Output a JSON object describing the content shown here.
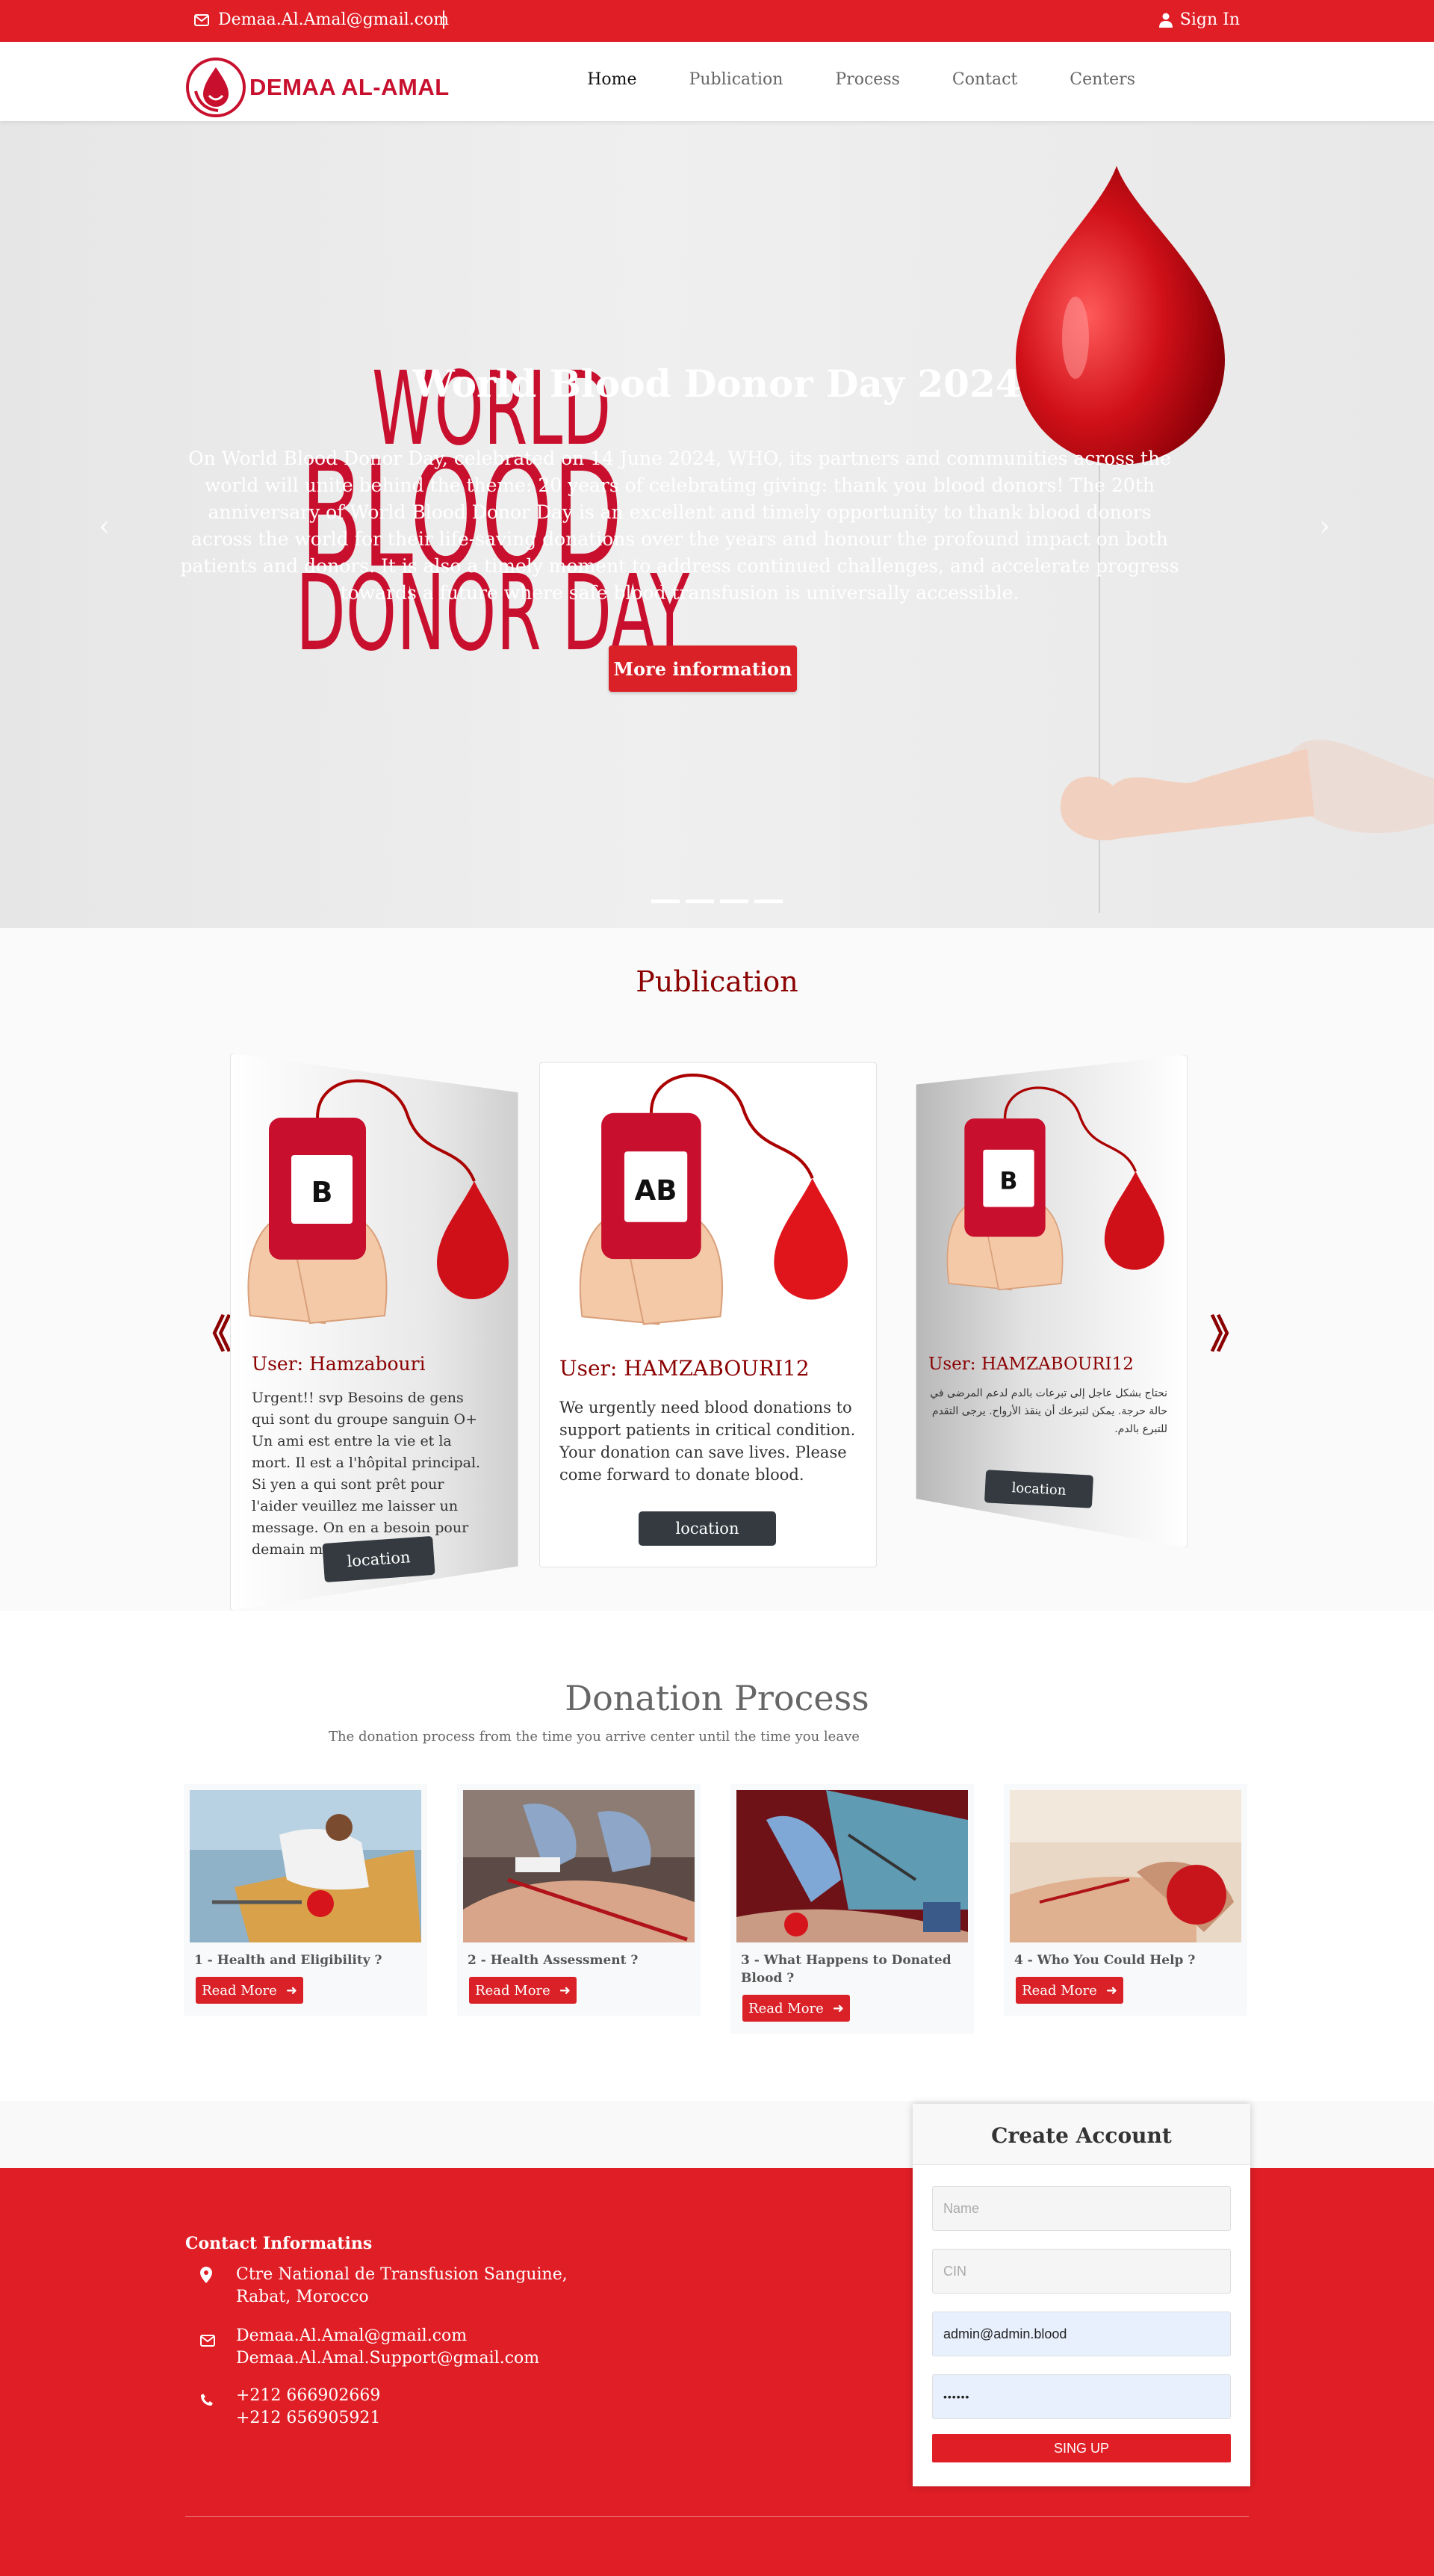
{
  "topbar": {
    "email": "Demaa.Al.Amal@gmail.com",
    "separator": "|",
    "signin": "Sign In"
  },
  "brand": {
    "name": "DEMAA AL-AMAL",
    "color": "#c8102e"
  },
  "nav": {
    "items": [
      "Home",
      "Publication",
      "Process",
      "Contact",
      "Centers"
    ],
    "active": "Home"
  },
  "hero": {
    "bg_word_1": "WORLD",
    "bg_word_2": "BLOOD",
    "bg_word_3": "DONOR DAY",
    "title": "World Blood Donor Day 2024",
    "description": "On World Blood Donor Day, celebrated on 14 June 2024, WHO, its partners and communities across the world will unite behind the theme: 20 years of celebrating giving: thank you blood donors! The 20th anniversary of World Blood Donor Day is an excellent and timely opportunity to thank blood donors across the world for their life-saving donations over the years and honour the profound impact on both patients and donors. It is also a timely moment to address continued challenges, and accelerate progress towards a future where safe blood transfusion is universally accessible.",
    "button": "More information",
    "prev_icon": "chevron-left-icon",
    "next_icon": "chevron-right-icon",
    "slides_count": 4
  },
  "publication": {
    "heading": "Publication",
    "prev_label": "《",
    "next_label": "》",
    "cards": [
      {
        "blood_type": "B",
        "user": "User: Hamzabouri",
        "text": "Urgent!! svp Besoins de gens qui sont du groupe sanguin O+ Un ami est entre la vie et la mort. Il est a l'hôpital principal. Si yen a qui sont prêt pour l'aider veuillez me laisser un message. On en a besoin pour demain matin. Svp",
        "button": "location"
      },
      {
        "blood_type": "AB",
        "user": "User: HAMZABOURI12",
        "text": "We urgently need blood donations to support patients in critical condition. Your donation can save lives. Please come forward to donate blood.",
        "button": "location"
      },
      {
        "blood_type": "B",
        "user": "User: HAMZABOURI12",
        "text": "نحتاج بشكل عاجل إلى تبرعات بالدم لدعم المرضى في حالة حرجة. يمكن لتبرعك أن ينقذ الأرواح. يرجى التقدم للتبرع بالدم.",
        "button": "location"
      }
    ]
  },
  "process": {
    "heading": "Donation Process",
    "subtitle": "The donation process from the time you arrive center until the time you leave",
    "steps": [
      {
        "title": "1 - Health and Eligibility ?",
        "button": "Read More"
      },
      {
        "title": "2 - Health Assessment ?",
        "button": "Read More"
      },
      {
        "title": "3 - What Happens to Donated Blood ?",
        "button": "Read More"
      },
      {
        "title": "4 - Who You Could Help ?",
        "button": "Read More"
      }
    ]
  },
  "footer": {
    "heading": "Contact Informatins",
    "address_line1": "Ctre National de Transfusion Sanguine,",
    "address_line2": "Rabat, Morocco",
    "email1": "Demaa.Al.Amal@gmail.com",
    "email2": "Demaa.Al.Amal.Support@gmail.com",
    "phone1": "+212 666902669",
    "phone2": "+212 656905921"
  },
  "signup": {
    "title": "Create Account",
    "name_placeholder": "Name",
    "cin_placeholder": "CIN",
    "email_value": "admin@admin.blood",
    "password_value": "••••••",
    "button": "SING UP"
  },
  "colors": {
    "primary_red": "#e01e26",
    "dark_red": "#8b0000",
    "button_dark": "#343a40"
  }
}
